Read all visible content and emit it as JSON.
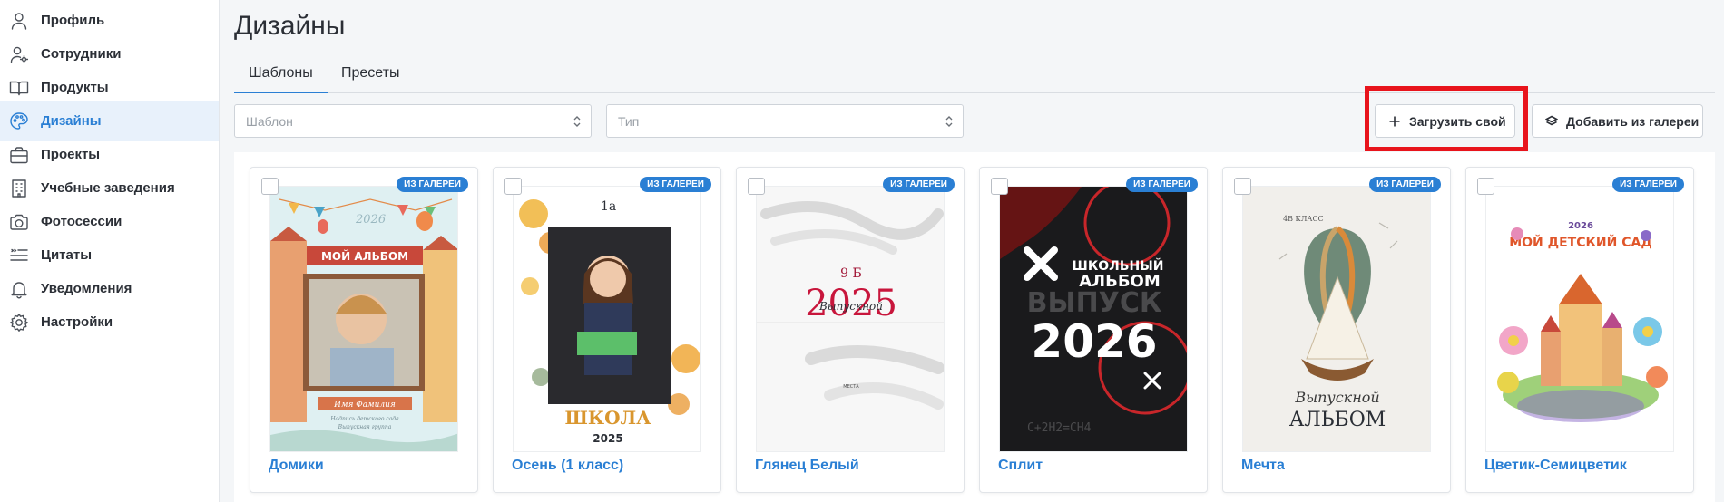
{
  "sidebar": {
    "items": [
      {
        "label": "Профиль",
        "icon": "user-icon",
        "active": false
      },
      {
        "label": "Сотрудники",
        "icon": "user-gear-icon",
        "active": false
      },
      {
        "label": "Продукты",
        "icon": "book-icon",
        "active": false
      },
      {
        "label": "Дизайны",
        "icon": "palette-icon",
        "active": true
      },
      {
        "label": "Проекты",
        "icon": "briefcase-icon",
        "active": false
      },
      {
        "label": "Учебные заведения",
        "icon": "building-icon",
        "active": false
      },
      {
        "label": "Фотосессии",
        "icon": "camera-icon",
        "active": false
      },
      {
        "label": "Цитаты",
        "icon": "quote-list-icon",
        "active": false
      },
      {
        "label": "Уведомления",
        "icon": "bell-icon",
        "active": false
      },
      {
        "label": "Настройки",
        "icon": "gear-icon",
        "active": false
      }
    ]
  },
  "main": {
    "title": "Дизайны",
    "tabs": [
      {
        "label": "Шаблоны",
        "active": true
      },
      {
        "label": "Пресеты",
        "active": false
      }
    ],
    "filters": {
      "template_placeholder": "Шаблон",
      "type_placeholder": "Тип"
    },
    "buttons": {
      "upload_label": "Загрузить свой",
      "gallery_label": "Добавить из галереи"
    },
    "badge_label": "ИЗ ГАЛЕРЕИ",
    "cards": [
      {
        "name": "Домики",
        "art": {
          "year": "2026",
          "title": "МОЙ АЛЬБОМ",
          "caption": "Имя Фамилия",
          "subcaption": "Надпись детского сада",
          "subcaption2": "Выпускная группа"
        }
      },
      {
        "name": "Осень (1 класс)",
        "art": {
          "grade": "1а",
          "school": "ШКОЛА",
          "year": "2025"
        }
      },
      {
        "name": "Глянец Белый",
        "art": {
          "grade": "9 Б",
          "year": "2025",
          "script": "Выпускной",
          "small": "МЕСТА"
        }
      },
      {
        "name": "Сплит",
        "art": {
          "line1": "ШКОЛЬНЫЙ",
          "line2": "АЛЬБОМ",
          "line3": "ВЫПУСК",
          "year": "2026",
          "formula": "C+2H2=CH4"
        }
      },
      {
        "name": "Мечта",
        "art": {
          "grade": "4В КЛАСС",
          "script": "Выпускной",
          "title": "АЛЬБОМ"
        }
      },
      {
        "name": "Цветик-Семицветик",
        "art": {
          "year": "2026",
          "title": "МОЙ ДЕТСКИЙ САД"
        }
      }
    ]
  },
  "colors": {
    "accent": "#2a7fd4",
    "highlight": "#e8141c",
    "active_bg": "#e8f1fb"
  }
}
